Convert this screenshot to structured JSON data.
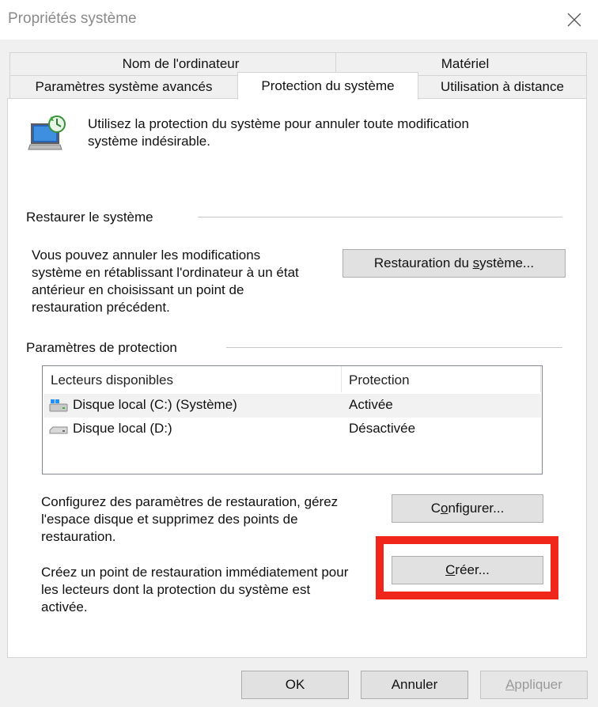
{
  "window": {
    "title": "Propriétés système"
  },
  "tabs": {
    "row1": [
      {
        "label": "Nom de l'ordinateur"
      },
      {
        "label": "Matériel"
      }
    ],
    "row2": [
      {
        "label": "Paramètres système avancés"
      },
      {
        "label": "Protection du système",
        "active": true
      },
      {
        "label": "Utilisation à distance"
      }
    ]
  },
  "intro": {
    "text_line1": "Utilisez la protection du système pour annuler toute modification",
    "text_line2": "système indésirable."
  },
  "restore": {
    "group_label": "Restaurer le système",
    "desc_line1": "Vous pouvez annuler les modifications",
    "desc_line2": "système en rétablissant l'ordinateur à un état",
    "desc_line3": "antérieur en choisissant un point de",
    "desc_line4": "restauration précédent.",
    "button_pre": "Restauration du ",
    "button_u": "s",
    "button_post": "ystème..."
  },
  "protection": {
    "group_label": "Paramètres de protection",
    "columns": {
      "drives": "Lecteurs disponibles",
      "protection": "Protection"
    },
    "drives": [
      {
        "name": "Disque local (C:) (Système)",
        "status": "Activée",
        "icon": "system-drive-icon"
      },
      {
        "name": "Disque local (D:)",
        "status": "Désactivée",
        "icon": "drive-icon"
      }
    ],
    "configure_text_line1": "Configurez des paramètres de restauration, gérez",
    "configure_text_line2": "l'espace disque et supprimez des points de",
    "configure_text_line3": "restauration.",
    "configure_pre": "C",
    "configure_u": "o",
    "configure_post": "nfigurer...",
    "create_text_line1": "Créez un point de restauration immédiatement pour",
    "create_text_line2": "les lecteurs dont la protection du système est",
    "create_text_line3": "activée.",
    "create_pre": "",
    "create_u": "C",
    "create_post": "réer..."
  },
  "footer": {
    "ok": "OK",
    "cancel": "Annuler",
    "apply_u": "A",
    "apply_post": "ppliquer"
  },
  "colors": {
    "highlight": "#f0261a",
    "window_bg": "#f0f0f0",
    "panel_bg": "#ffffff"
  }
}
